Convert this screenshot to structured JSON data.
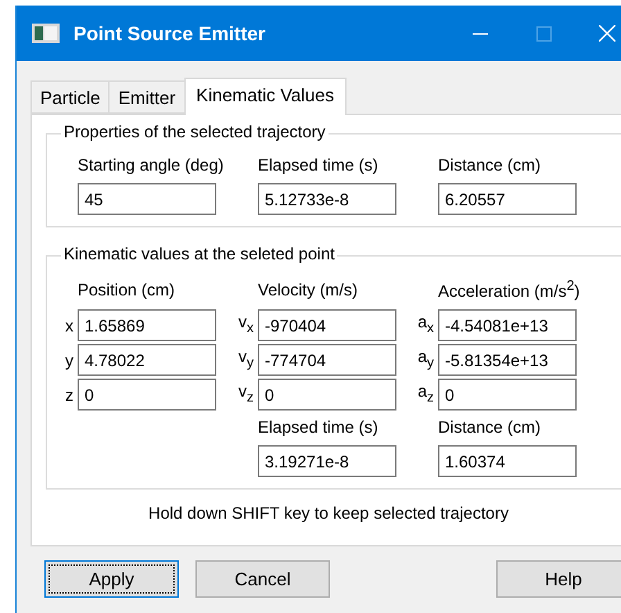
{
  "window": {
    "title": "Point Source Emitter"
  },
  "tabs": [
    {
      "label": "Particle",
      "selected": false
    },
    {
      "label": "Emitter",
      "selected": false
    },
    {
      "label": "Kinematic Values",
      "selected": true
    }
  ],
  "trajectory": {
    "title": "Properties of the selected trajectory",
    "fields": [
      {
        "label": "Starting angle (deg)",
        "value": "45"
      },
      {
        "label": "Elapsed time (s)",
        "value": "5.12733e-8"
      },
      {
        "label": "Distance (cm)",
        "value": "6.20557"
      }
    ]
  },
  "point": {
    "title": "Kinematic values at the seleted point",
    "headers": [
      "Position (cm)",
      "Velocity (m/s)",
      "Acceleration (m/s$^{2}$)"
    ],
    "rows": [
      [
        {
          "prefix": "x",
          "value": "1.65869"
        },
        {
          "prefix": "v$_{x}$",
          "value": "-970404"
        },
        {
          "prefix": "a$_{x}$",
          "value": "-4.54081e+13"
        }
      ],
      [
        {
          "prefix": "y",
          "value": "4.78022"
        },
        {
          "prefix": "v$_{y}$",
          "value": "-774704"
        },
        {
          "prefix": "a$_{y}$",
          "value": "-5.81354e+13"
        }
      ],
      [
        {
          "prefix": "z",
          "value": "0"
        },
        {
          "prefix": "v$_{z}$",
          "value": "0"
        },
        {
          "prefix": "a$_{z}$",
          "value": "0"
        }
      ]
    ],
    "extra": [
      {
        "label": "Elapsed time (s)",
        "value": "3.19271e-8"
      },
      {
        "label": "Distance (cm)",
        "value": "1.60374"
      }
    ]
  },
  "hint": "Hold down SHIFT key to keep selected trajectory",
  "buttons": [
    {
      "label": "Apply",
      "focused": true
    },
    {
      "label": "Cancel",
      "focused": false
    },
    {
      "label": "Help",
      "focused": false
    }
  ]
}
